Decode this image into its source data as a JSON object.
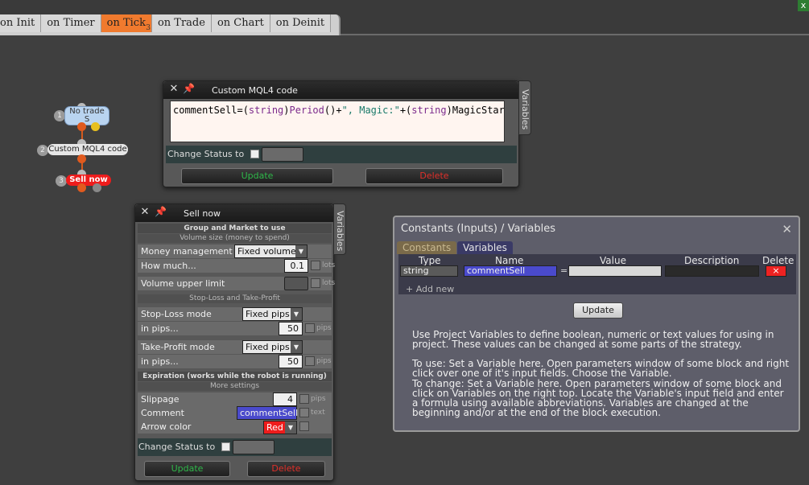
{
  "tabs": [
    {
      "label": "on Init"
    },
    {
      "label": "on Timer"
    },
    {
      "label": "on Tick",
      "sub": "3"
    },
    {
      "label": "on Trade"
    },
    {
      "label": "on Chart"
    },
    {
      "label": "on Deinit"
    }
  ],
  "corner_close": "x",
  "flow": {
    "node1": {
      "num": "1",
      "line1": "No trade",
      "line2": "S"
    },
    "node2": {
      "num": "2",
      "label": "Custom MQL4 code"
    },
    "node3": {
      "num": "3",
      "label": "Sell now"
    }
  },
  "code_panel": {
    "title": "Custom MQL4 code",
    "side_tab": "Variables",
    "code": {
      "p1": "commentSell=(",
      "p2": "string",
      "p3": ")",
      "p4": "Period",
      "p5": "()+",
      "p6": "\", Magic:\"",
      "p7": "+(",
      "p8": "string",
      "p9": ")MagicStart;"
    },
    "status_label": "Change Status to",
    "update": "Update",
    "delete": "Delete"
  },
  "sell_panel": {
    "title": "Sell now",
    "side_tab": "Variables",
    "group_market": "Group and Market to use",
    "volume_size": "Volume size (money to spend)",
    "money_mgmt_label": "Money management",
    "money_mgmt_value": "Fixed volume",
    "how_much_label": "How much...",
    "how_much_value": "0.1",
    "lots": "lots",
    "vol_upper_label": "Volume upper limit",
    "sl_tp_head": "Stop-Loss and Take-Profit",
    "sl_mode_label": "Stop-Loss mode",
    "sl_mode_value": "Fixed pips",
    "in_pips_label": "in pips...",
    "sl_pips_value": "50",
    "pips": "pips",
    "tp_mode_label": "Take-Profit mode",
    "tp_mode_value": "Fixed pips",
    "tp_pips_value": "50",
    "expiration_head": "Expiration (works while the robot is running)",
    "more_settings": "More settings",
    "slippage_label": "Slippage",
    "slippage_value": "4",
    "comment_label": "Comment",
    "comment_value": "commentSell",
    "text": "text",
    "arrow_label": "Arrow color",
    "arrow_value": "Red",
    "status_label": "Change Status to",
    "update": "Update",
    "delete": "Delete"
  },
  "constants": {
    "title": "Constants (Inputs) / Variables",
    "tab_constants": "Constants",
    "tab_variables": "Variables",
    "col_type": "Type",
    "col_name": "Name",
    "col_value": "Value",
    "col_description": "Description",
    "col_delete": "Delete",
    "row_type": "string",
    "row_name": "commentSell",
    "row_eq": "=",
    "row_del": "×",
    "add_new": "+ Add new",
    "update": "Update",
    "info1": "Use Project Variables to define boolean, numeric or text values for using in project. These values can be changed at some parts of the strategy.",
    "info2": "To use: Set a Variable here. Open parameters window of some block and right click over one of it's input fields. Choose the Variable.",
    "info3": "To change: Set a Variable here. Open parameters window of some block and click on Variables on the right top. Locate the Variable's input field and enter a formula using available abbreviations. Variables are changed at the beginning and/or at the end of the block execution."
  }
}
